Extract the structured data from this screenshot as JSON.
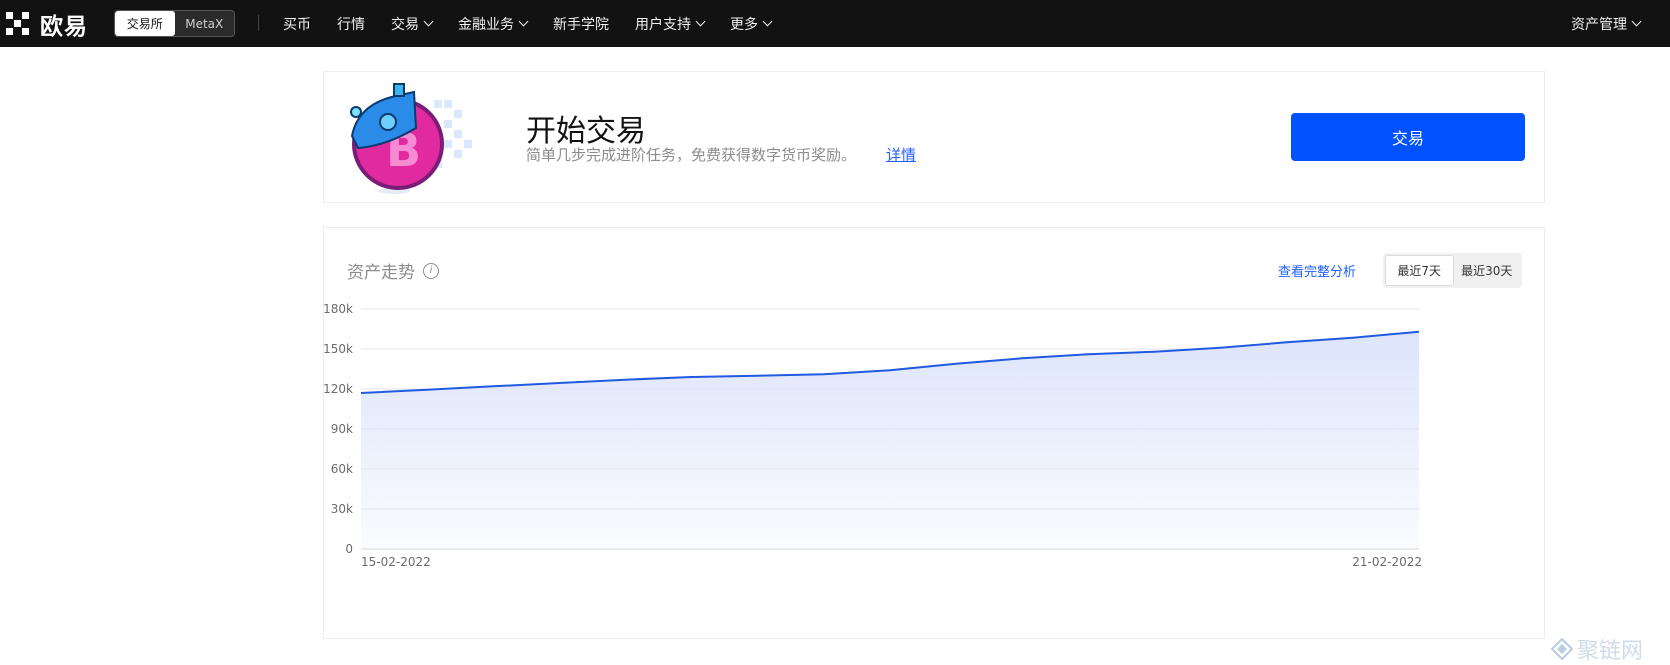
{
  "header": {
    "logo_text": "欧易",
    "switcher": {
      "active": "交易所",
      "inactive": "MetaX"
    },
    "nav": [
      {
        "label": "买币",
        "dropdown": false
      },
      {
        "label": "行情",
        "dropdown": false
      },
      {
        "label": "交易",
        "dropdown": true
      },
      {
        "label": "金融业务",
        "dropdown": true
      },
      {
        "label": "新手学院",
        "dropdown": false
      },
      {
        "label": "用户支持",
        "dropdown": true
      },
      {
        "label": "更多",
        "dropdown": true
      }
    ],
    "right": {
      "label": "资产管理",
      "dropdown": true
    }
  },
  "promo": {
    "title": "开始交易",
    "subtitle": "简单几步完成进阶任务，免费获得数字货币奖励。",
    "link": "详情",
    "button": "交易",
    "accent": "#0052ff"
  },
  "assets": {
    "title": "资产走势",
    "info_icon": "info-icon",
    "analysis_link": "查看完整分析",
    "ranges": [
      "最近7天",
      "最近30天"
    ],
    "active_range": "最近7天"
  },
  "chart_data": {
    "type": "area",
    "x_tick_labels": [
      "15-02-2022",
      "21-02-2022"
    ],
    "yticks": [
      0,
      30000,
      60000,
      90000,
      120000,
      150000,
      180000
    ],
    "ytick_labels": [
      "0",
      "30k",
      "60k",
      "90k",
      "120k",
      "150k",
      "180k"
    ],
    "ylim": [
      0,
      180000
    ],
    "grid": true,
    "line_color": "#1f5ae0",
    "fill_color": "#dbe3fb",
    "series": [
      {
        "values": [
          117000,
          119500,
          122000,
          124500,
          127000,
          129000,
          130000,
          131000,
          134000,
          139000,
          143000,
          146000,
          148000,
          151000,
          155000,
          158500,
          163000
        ]
      }
    ]
  },
  "watermark": "聚链网"
}
